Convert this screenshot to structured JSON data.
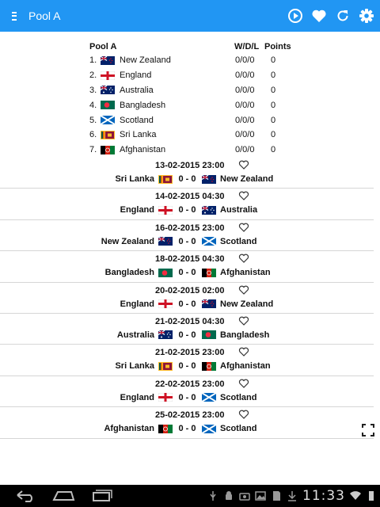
{
  "app": {
    "title": "Pool A"
  },
  "standings": {
    "header": {
      "pool": "Pool A",
      "wdl": "W/D/L",
      "points": "Points"
    },
    "rows": [
      {
        "num": "1.",
        "team": "New Zealand",
        "wdl": "0/0/0",
        "pts": "0",
        "flag": "nz"
      },
      {
        "num": "2.",
        "team": "England",
        "wdl": "0/0/0",
        "pts": "0",
        "flag": "eng"
      },
      {
        "num": "3.",
        "team": "Australia",
        "wdl": "0/0/0",
        "pts": "0",
        "flag": "aus"
      },
      {
        "num": "4.",
        "team": "Bangladesh",
        "wdl": "0/0/0",
        "pts": "0",
        "flag": "ban"
      },
      {
        "num": "5.",
        "team": "Scotland",
        "wdl": "0/0/0",
        "pts": "0",
        "flag": "sco"
      },
      {
        "num": "6.",
        "team": "Sri Lanka",
        "wdl": "0/0/0",
        "pts": "0",
        "flag": "sl"
      },
      {
        "num": "7.",
        "team": "Afghanistan",
        "wdl": "0/0/0",
        "pts": "0",
        "flag": "afg"
      }
    ]
  },
  "matches": [
    {
      "date": "13-02-2015 23:00",
      "home": "Sri Lanka",
      "home_flag": "sl",
      "score": "0 - 0",
      "away": "New Zealand",
      "away_flag": "nz"
    },
    {
      "date": "14-02-2015 04:30",
      "home": "England",
      "home_flag": "eng",
      "score": "0 - 0",
      "away": "Australia",
      "away_flag": "aus"
    },
    {
      "date": "16-02-2015 23:00",
      "home": "New Zealand",
      "home_flag": "nz",
      "score": "0 - 0",
      "away": "Scotland",
      "away_flag": "sco"
    },
    {
      "date": "18-02-2015 04:30",
      "home": "Bangladesh",
      "home_flag": "ban",
      "score": "0 - 0",
      "away": "Afghanistan",
      "away_flag": "afg"
    },
    {
      "date": "20-02-2015 02:00",
      "home": "England",
      "home_flag": "eng",
      "score": "0 - 0",
      "away": "New Zealand",
      "away_flag": "nz"
    },
    {
      "date": "21-02-2015 04:30",
      "home": "Australia",
      "home_flag": "aus",
      "score": "0 - 0",
      "away": "Bangladesh",
      "away_flag": "ban"
    },
    {
      "date": "21-02-2015 23:00",
      "home": "Sri Lanka",
      "home_flag": "sl",
      "score": "0 - 0",
      "away": "Afghanistan",
      "away_flag": "afg"
    },
    {
      "date": "22-02-2015 23:00",
      "home": "England",
      "home_flag": "eng",
      "score": "0 - 0",
      "away": "Scotland",
      "away_flag": "sco"
    },
    {
      "date": "25-02-2015 23:00",
      "home": "Afghanistan",
      "home_flag": "afg",
      "score": "0 - 0",
      "away": "Scotland",
      "away_flag": "sco"
    }
  ],
  "status_bar": {
    "time": "11:33"
  },
  "icons": {
    "menu": "menu-icon",
    "play": "play-circle-icon",
    "favorite": "heart-icon",
    "refresh": "refresh-icon",
    "settings": "gear-icon",
    "expand": "fullscreen-icon"
  },
  "colors": {
    "toolbar": "#2196f3",
    "navbar": "#000000"
  }
}
